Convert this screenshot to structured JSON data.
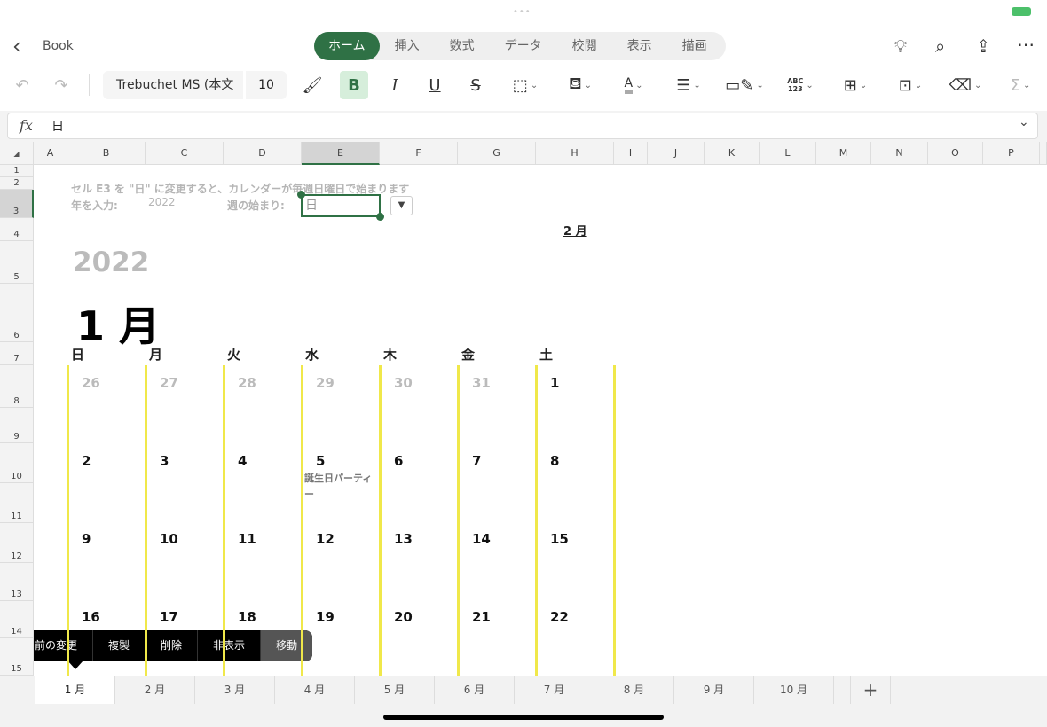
{
  "app": {
    "back_label": "Book",
    "tabs": [
      "ホーム",
      "挿入",
      "数式",
      "データ",
      "校閲",
      "表示",
      "描画"
    ],
    "active_tab": "ホーム"
  },
  "toolbar": {
    "font_name": "Trebuchet MS (本文",
    "font_size": "10",
    "bold": "B",
    "italic": "I",
    "underline": "U",
    "strike": "S",
    "number_format": "ABC\n123",
    "sum": "Σ"
  },
  "formula_bar": {
    "fx": "fx",
    "value": "日"
  },
  "columns": [
    "A",
    "B",
    "C",
    "D",
    "E",
    "F",
    "G",
    "H",
    "I",
    "J",
    "K",
    "L",
    "M",
    "N",
    "O",
    "P"
  ],
  "selected_column": "E",
  "rows": [
    "1",
    "2",
    "3",
    "4",
    "5",
    "6",
    "7",
    "8",
    "9",
    "10",
    "11",
    "12",
    "13",
    "14",
    "15"
  ],
  "selected_row": "3",
  "sheet": {
    "instruction": "セル E3 を \"日\" に変更すると、カレンダーが毎週日曜日で始まります",
    "year_label": "年を入力:",
    "year_value": "2022",
    "week_start_label": "週の始まり:",
    "week_start_value": "日",
    "next_month": "2 月",
    "year_big": "2022",
    "month_big": "1 月",
    "weekdays": [
      "日",
      "月",
      "火",
      "水",
      "木",
      "金",
      "土"
    ],
    "weeks": [
      [
        "26",
        "27",
        "28",
        "29",
        "30",
        "31",
        "1"
      ],
      [
        "2",
        "3",
        "4",
        "5",
        "6",
        "7",
        "8"
      ],
      [
        "9",
        "10",
        "11",
        "12",
        "13",
        "14",
        "15"
      ],
      [
        "16",
        "17",
        "18",
        "19",
        "20",
        "21",
        "22"
      ]
    ],
    "event": "誕生日パーティー"
  },
  "context_menu": [
    "名前の変更",
    "複製",
    "削除",
    "非表示",
    "移動"
  ],
  "sheet_tabs": [
    "1 月",
    "2 月",
    "3 月",
    "4 月",
    "5 月",
    "6 月",
    "7 月",
    "8 月",
    "9 月",
    "10 月"
  ],
  "active_sheet": "1 月",
  "colors": {
    "accent": "#2f7145",
    "calendar_line": "#f0e84a"
  }
}
